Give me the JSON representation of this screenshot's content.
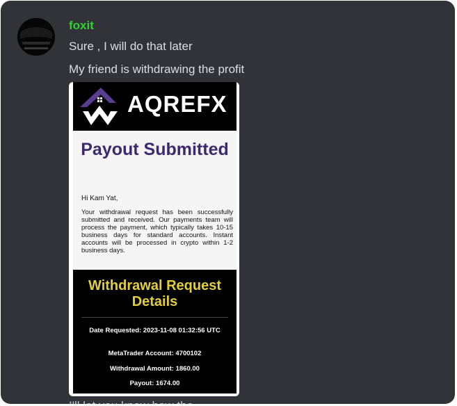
{
  "message": {
    "author": "foxit",
    "lines": [
      "Sure , I will do that later",
      "My friend is withdrawing the profit"
    ],
    "next_line_partial": "I'll let you know how the"
  },
  "attachment": {
    "brand": "AQREFX",
    "title": "Payout Submitted",
    "greeting": "Hi Kam Yat,",
    "body": "Your withdrawal request has been successfully submitted and received. Our payments team will process the payment, which typically takes 10-15 business days for standard accounts. Instant accounts will be processed in crypto within 1-2 business days.",
    "details_title": "Withdrawal Request Details",
    "date_requested": "Date Requested: 2023-11-08 01:32:56 UTC",
    "metatrader_account": "MetaTrader Account: 4700102",
    "withdrawal_amount": "Withdrawal Amount: 1860.00",
    "payout": "Payout: 1674.00"
  },
  "colors": {
    "background": "#313338",
    "username": "#2ed12e",
    "message_text": "#dbdee1",
    "brand_purple": "#5a3d91",
    "title_purple": "#3c2a6e",
    "details_yellow": "#e3cf3a"
  },
  "icons": {
    "avatar": "avatar-image",
    "brand_logo": "aqrefx-logo-icon"
  }
}
